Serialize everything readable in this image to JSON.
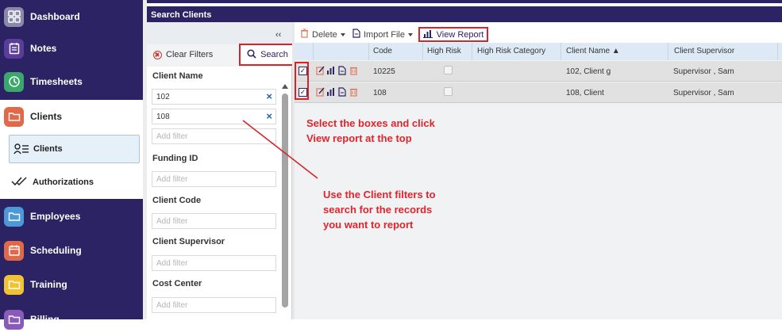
{
  "nav": {
    "items": [
      {
        "label": "Dashboard",
        "icon": "dashboard-icon",
        "color": "#8a8aa8"
      },
      {
        "label": "Notes",
        "icon": "notes-icon",
        "color": "#5a3d9a"
      },
      {
        "label": "Timesheets",
        "icon": "clock-icon",
        "color": "#3aa86b"
      },
      {
        "label": "Clients",
        "icon": "folder-icon",
        "color": "#e0694a"
      },
      {
        "label": "Employees",
        "icon": "folder-icon",
        "color": "#4c98d8"
      },
      {
        "label": "Scheduling",
        "icon": "calendar-icon",
        "color": "#e0694a"
      },
      {
        "label": "Training",
        "icon": "folder-icon",
        "color": "#f1c232"
      },
      {
        "label": "Billing",
        "icon": "folder-icon",
        "color": "#8a5ab8"
      }
    ],
    "sub_items": [
      {
        "label": "Clients",
        "icon": "client-list-icon"
      },
      {
        "label": "Authorizations",
        "icon": "check-double-icon"
      }
    ]
  },
  "panel": {
    "title": "Search Clients"
  },
  "filters": {
    "collapse": "‹‹",
    "clear_label": "Clear Filters",
    "search_label": "Search",
    "client_name_label": "Client Name",
    "client_name_values": [
      "102",
      "108"
    ],
    "add_filter_placeholder": "Add filter",
    "funding_id_label": "Funding ID",
    "client_code_label": "Client Code",
    "client_supervisor_label": "Client Supervisor",
    "cost_center_label": "Cost Center"
  },
  "toolbar": {
    "delete_label": "Delete",
    "import_label": "Import File",
    "view_report_label": "View Report"
  },
  "table": {
    "columns": [
      "Code",
      "High Risk",
      "High Risk Category",
      "Client Name",
      "Client Supervisor"
    ],
    "sort_indicator": "▲",
    "rows": [
      {
        "code": "10225",
        "high_risk": false,
        "high_risk_category": "",
        "client_name": "102, Client g",
        "client_supervisor": "Supervisor , Sam",
        "checked": true
      },
      {
        "code": "108",
        "high_risk": false,
        "high_risk_category": "",
        "client_name": "108, Client",
        "client_supervisor": "Supervisor , Sam",
        "checked": true
      }
    ]
  },
  "annotations": {
    "select_note_line1": "Select the boxes and click",
    "select_note_line2": "View report at the top",
    "filter_note_line1": "Use the Client filters to",
    "filter_note_line2": "search for the records",
    "filter_note_line3": "you want to report"
  },
  "colors": {
    "nav_bg": "#2b2363",
    "highlight": "#d8232a",
    "annotation": "#e0242b",
    "header_bg": "#ddeaf5"
  }
}
